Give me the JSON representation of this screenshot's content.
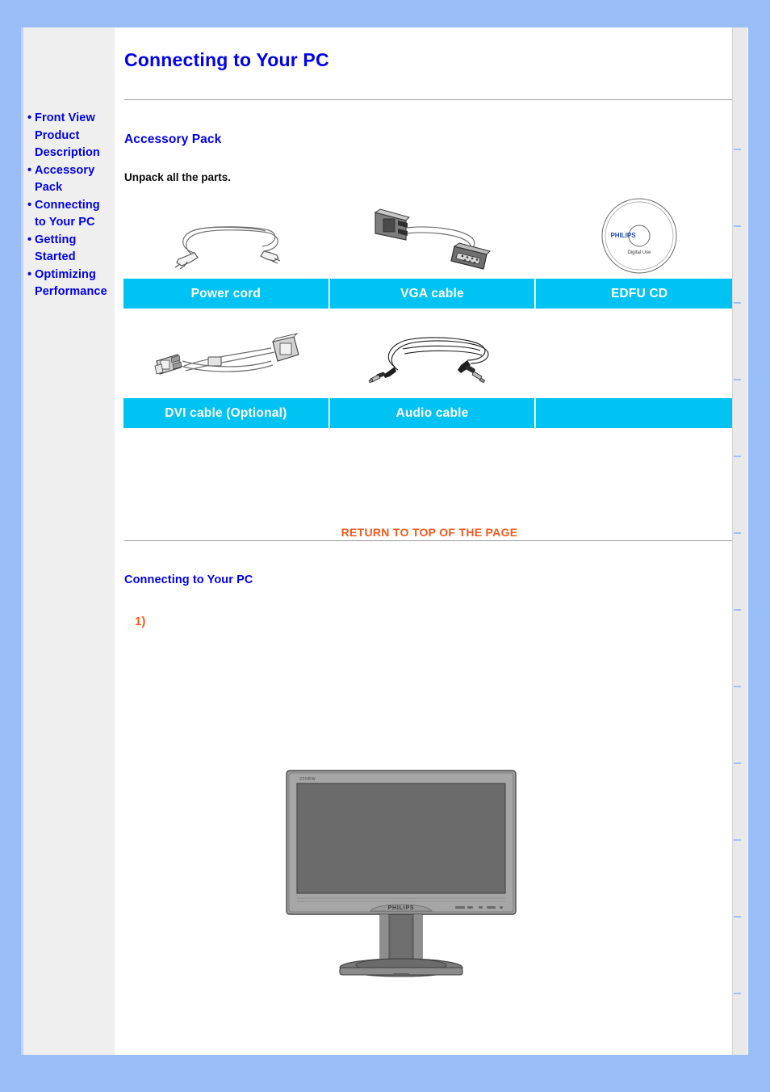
{
  "theme": {
    "page_background": "#99BDF7",
    "content_background": "#FFFFFF",
    "sidebar_background": "#EFEFEF",
    "link_blue": "#0000E8",
    "accent_cyan": "#00C2F3",
    "accent_orange": "#F15A1E",
    "rule_gray": "#9A9A9A"
  },
  "header": {
    "title": "Connecting to Your PC"
  },
  "sidebar": {
    "items": [
      {
        "bullet": "•",
        "line1": "Front View",
        "line2": "Product",
        "line3": "Description"
      },
      {
        "bullet": "•",
        "line1": "Accessory",
        "line2": "Pack",
        "line3": ""
      },
      {
        "bullet": "•",
        "line1": "Connecting",
        "line2": "to Your PC",
        "line3": ""
      },
      {
        "bullet": "•",
        "line1": "Getting",
        "line2": "Started",
        "line3": ""
      },
      {
        "bullet": "•",
        "line1": "Optimizing",
        "line2": "Performance",
        "line3": ""
      }
    ]
  },
  "main": {
    "accessory_section": {
      "heading": "Accessory Pack",
      "instruction": "Unpack all the parts.",
      "items": [
        {
          "label": "Power cord",
          "icon": "power-cord-image"
        },
        {
          "label": "VGA cable",
          "icon": "vga-cable-image"
        },
        {
          "label": "EDFU CD",
          "icon": "edfu-cd-image"
        },
        {
          "label": "DVI cable (Optional)",
          "icon": "dvi-cable-image"
        },
        {
          "label": "Audio cable",
          "icon": "audio-cable-image"
        },
        {
          "label": "",
          "icon": ""
        }
      ]
    },
    "return_to_top": "RETURN TO TOP OF THE PAGE",
    "connecting_section": {
      "heading": "Connecting to Your PC",
      "step_number": "1)",
      "monitor": {
        "brand": "PHILIPS",
        "model_label": "220BW",
        "icon": "lcd-monitor-front-image"
      }
    },
    "cd_art": {
      "brand": "PHILIPS",
      "caption": "Digital Use"
    }
  }
}
